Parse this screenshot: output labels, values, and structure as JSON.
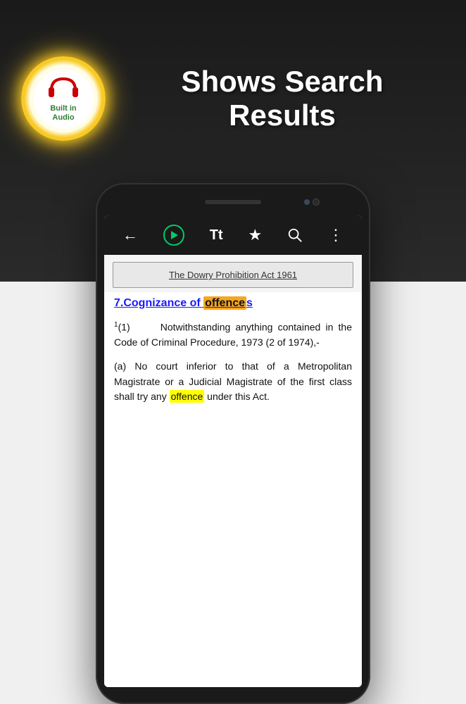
{
  "header": {
    "title_line1": "Shows Search",
    "title_line2": "Results",
    "logo_text_line1": "Built in",
    "logo_text_line2": "Audio"
  },
  "toolbar": {
    "back_label": "←",
    "play_label": "▶",
    "text_size_label": "Tt",
    "bookmark_label": "★",
    "search_label": "🔍",
    "more_label": "⋮"
  },
  "act_title": "The Dowry Prohibition Act 1961",
  "section": {
    "heading_prefix": "7.Cognizance of ",
    "heading_highlight": "offence",
    "heading_suffix": "s",
    "paragraph1": {
      "superscript": "1",
      "number": "(1)",
      "text": "Notwithstanding anything contained in the Code of Criminal Procedure, 1973 (2 of 1974),-"
    },
    "paragraph2": {
      "label": "(a)",
      "text_before": "No court inferior to that of a Metropolitan Magistrate or a Judicial Magistrate of the first class shall try any ",
      "highlight": "offence",
      "text_after": " under this Act."
    }
  },
  "colors": {
    "highlight_orange": "#f5a623",
    "highlight_yellow": "#ffff00",
    "heading_color": "#1a1aff",
    "toolbar_bg": "#1a1a1a",
    "play_color": "#00cc66"
  }
}
